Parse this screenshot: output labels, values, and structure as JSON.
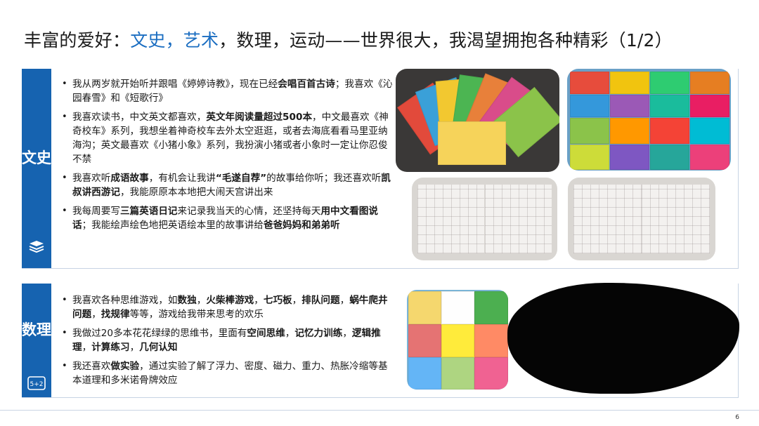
{
  "title": {
    "prefix": "丰富的爱好：",
    "highlight": "文史，艺术",
    "suffix": "，数理，运动——世界很大，我渴望拥抱各种精彩（1/2）"
  },
  "section1": {
    "label": "文史",
    "icon": "books-icon",
    "bullets": [
      [
        {
          "t": "我从两岁就开始听并跟唱《婷婷诗教》，现在已经",
          "b": false
        },
        {
          "t": "会唱百首古诗",
          "b": true
        },
        {
          "t": "；我喜欢《沁园春雪》和《短歌行》",
          "b": false
        }
      ],
      [
        {
          "t": "我喜欢读书，中文英文都喜欢，",
          "b": false
        },
        {
          "t": "英文年阅读量超过500本",
          "b": true
        },
        {
          "t": "，中文最喜欢《神奇校车》系列，我想坐着神奇校车去外太空逛逛，或者去海底看看马里亚纳海沟；英文最喜欢《小猪小象》系列，我扮演小猪或者小象时一定让你忍俊不禁",
          "b": false
        }
      ],
      [
        {
          "t": "我喜欢听",
          "b": false
        },
        {
          "t": "成语故事",
          "b": true
        },
        {
          "t": "，有机会让我讲",
          "b": false
        },
        {
          "t": "“毛遂自荐”",
          "b": true
        },
        {
          "t": "的故事给你听；我还喜欢听",
          "b": false
        },
        {
          "t": "凯叔讲西游记",
          "b": true
        },
        {
          "t": "，我能原原本本地把大闹天宫讲出来",
          "b": false
        }
      ],
      [
        {
          "t": "我每周要写",
          "b": false
        },
        {
          "t": "三篇英语日记",
          "b": true
        },
        {
          "t": "来记录我当天的心情，还坚持每天",
          "b": false
        },
        {
          "t": "用中文看图说话",
          "b": true
        },
        {
          "t": "；我能绘声绘色地把英语绘本里的故事讲给",
          "b": false
        },
        {
          "t": "爸爸妈妈和弟弟听",
          "b": true
        }
      ]
    ]
  },
  "section2": {
    "label": "数理",
    "icon": "math-icon",
    "icon_text": "5+2",
    "bullets": [
      [
        {
          "t": "我喜欢各种思维游戏，如",
          "b": false
        },
        {
          "t": "数独",
          "b": true
        },
        {
          "t": "，",
          "b": false
        },
        {
          "t": "火柴棒游戏",
          "b": true
        },
        {
          "t": "，",
          "b": false
        },
        {
          "t": "七巧板",
          "b": true
        },
        {
          "t": "，",
          "b": false
        },
        {
          "t": "排队问题",
          "b": true
        },
        {
          "t": "，",
          "b": false
        },
        {
          "t": "蜗牛爬井问题",
          "b": true
        },
        {
          "t": "，",
          "b": false
        },
        {
          "t": "找规律",
          "b": true
        },
        {
          "t": "等等，游戏给我带来思考的欢乐",
          "b": false
        }
      ],
      [
        {
          "t": "我做过20多本花花绿绿的思维书，里面有",
          "b": false
        },
        {
          "t": "空间思维",
          "b": true
        },
        {
          "t": "，",
          "b": false
        },
        {
          "t": "记忆力训练",
          "b": true
        },
        {
          "t": "，",
          "b": false
        },
        {
          "t": "逻辑推理",
          "b": true
        },
        {
          "t": "，",
          "b": false
        },
        {
          "t": "计算练习",
          "b": true
        },
        {
          "t": "，",
          "b": false
        },
        {
          "t": "几何认知",
          "b": true
        }
      ],
      [
        {
          "t": "我还喜欢",
          "b": false
        },
        {
          "t": "做实验",
          "b": true
        },
        {
          "t": "，通过实验了解了浮力、密度、磁力、重力、热胀冷缩等基本道理和多米诺骨牌效应",
          "b": false
        }
      ]
    ]
  },
  "page_number": "6",
  "colors": {
    "accent": "#1a6dc1",
    "side_bar": "#1663b0"
  }
}
